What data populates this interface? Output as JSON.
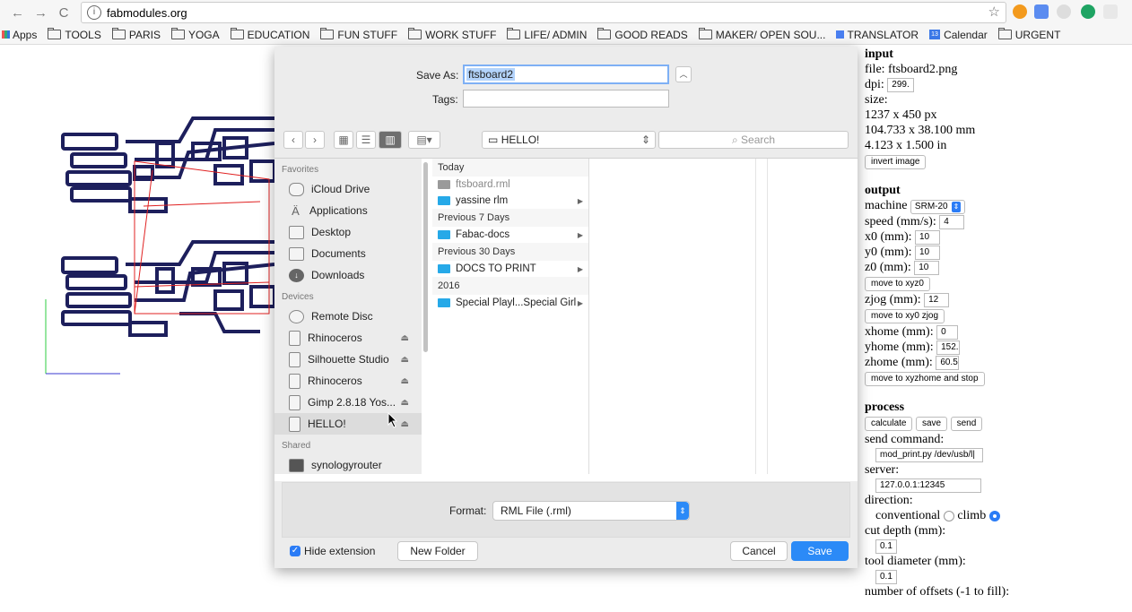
{
  "browser": {
    "url": "fabmodules.org",
    "bookmarks": [
      "Apps",
      "TOOLS",
      "PARIS",
      "YOGA",
      "EDUCATION",
      "FUN STUFF",
      "WORK STUFF",
      "LIFE/ ADMIN",
      "GOOD READS",
      "MAKER/ OPEN SOU...",
      "TRANSLATOR",
      "Calendar",
      "URGENT"
    ],
    "calendar_day": "13"
  },
  "dialog": {
    "save_as_label": "Save As:",
    "save_as_value": "ftsboard2",
    "tags_label": "Tags:",
    "tags_value": "",
    "location": "HELLO!",
    "search_placeholder": "Search",
    "sidebar": {
      "favorites_header": "Favorites",
      "favorites": [
        "iCloud Drive",
        "Applications",
        "Desktop",
        "Documents",
        "Downloads"
      ],
      "devices_header": "Devices",
      "devices": [
        "Remote Disc",
        "Rhinoceros",
        "Silhouette Studio",
        "Rhinoceros",
        "Gimp 2.8.18 Yos...",
        "HELLO!"
      ],
      "shared_header": "Shared",
      "shared": [
        "synologyrouter"
      ]
    },
    "files": {
      "today_header": "Today",
      "today": [
        "ftsboard.rml",
        "yassine rlm"
      ],
      "prev7_header": "Previous 7 Days",
      "prev7": [
        "Fabac-docs"
      ],
      "prev30_header": "Previous 30 Days",
      "prev30": [
        "DOCS TO PRINT"
      ],
      "y2016_header": "2016",
      "y2016": [
        "Special Playl...Special Girl"
      ]
    },
    "format_label": "Format:",
    "format_value": "RML File (.rml)",
    "hide_extension_label": "Hide extension",
    "new_folder_label": "New Folder",
    "cancel_label": "Cancel",
    "save_label": "Save"
  },
  "panel": {
    "input_header": "input",
    "file_line": "file: ftsboard2.png",
    "dpi_label": "dpi:",
    "dpi_value": "299.",
    "size_label": "size:",
    "size_px": "1237 x 450 px",
    "size_mm": "104.733 x 38.100 mm",
    "size_in": "4.123 x 1.500 in",
    "invert_label": "invert image",
    "output_header": "output",
    "machine_label": "machine",
    "machine_value": "SRM-20",
    "speed_label": "speed (mm/s):",
    "speed_value": "4",
    "x0_label": "x0 (mm):",
    "x0_value": "10",
    "y0_label": "y0 (mm):",
    "y0_value": "10",
    "z0_label": "z0 (mm):",
    "z0_value": "10",
    "move_xyz0_label": "move to xyz0",
    "zjog_label": "zjog (mm):",
    "zjog_value": "12",
    "move_xy0_label": "move to xy0 zjog",
    "xhome_label": "xhome (mm):",
    "xhome_value": "0",
    "yhome_label": "yhome (mm):",
    "yhome_value": "152.",
    "zhome_label": "zhome (mm):",
    "zhome_value": "60.5",
    "move_home_label": "move to xyzhome and stop",
    "process_header": "process",
    "calculate_label": "calculate",
    "save_label": "save",
    "send_label": "send",
    "send_command_label": "send command:",
    "send_command_value": "mod_print.py /dev/usb/l|",
    "server_label": "server:",
    "server_value": "127.0.0.1:12345",
    "direction_label": "direction:",
    "conventional_label": "conventional",
    "climb_label": "climb",
    "cut_depth_label": "cut depth (mm):",
    "cut_depth_value": "0.1",
    "tool_diameter_label": "tool diameter (mm):",
    "tool_diameter_value": "0.1",
    "offsets_label": "number of offsets (-1 to fill):"
  },
  "colors": {
    "accent": "#2b8af7",
    "folder": "#26a9e8",
    "trace": "#1d1f5c",
    "toolpath": "#e02020"
  }
}
